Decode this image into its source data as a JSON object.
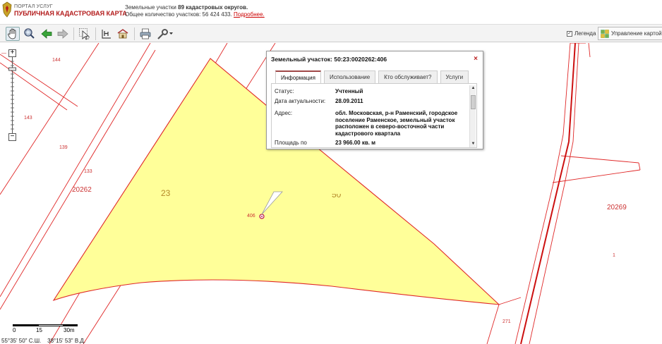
{
  "header": {
    "portal_label": "ПОРТАЛ УСЛУГ",
    "portal_title": "ПУБЛИЧНАЯ КАДАСТРОВАЯ КАРТА",
    "info_line1_prefix": "Земельные участки ",
    "info_line1_bold": "89 кадастровых округов.",
    "info_line2_prefix": "Общее количество участков: 56 424 433. ",
    "info_line2_link": "Подробнее."
  },
  "toolbar": {
    "legend_label": "Легенда",
    "legend_checked": "✓",
    "manage_label": "Управление картой",
    "icons": [
      "hand-icon",
      "zoom-area-icon",
      "back-arrow-icon",
      "forward-arrow-icon",
      "identify-icon",
      "measure-icon",
      "building-icon",
      "print-icon",
      "tools-icon"
    ]
  },
  "map": {
    "labels": [
      "144",
      "143",
      "139",
      "133",
      "20262",
      "406",
      "271",
      "20269",
      "1"
    ],
    "big_labels": [
      "23",
      "50"
    ],
    "parcel_color": "#ffff99",
    "boundary_color": "#e02828",
    "zoom_plus": "+",
    "zoom_minus": "−",
    "zoom_level_marker": "—",
    "scale": {
      "s0": "0",
      "s1": "15",
      "s2": "30m"
    },
    "coords": "55°35' 50\" С.Ш.    38°15' 53\" В.Д."
  },
  "popup": {
    "title": "Земельный участок: 50:23:0020262:406",
    "close": "×",
    "tabs": [
      "Информация",
      "Использование",
      "Кто обслуживает?",
      "Услуги"
    ],
    "fields": {
      "status_label": "Статус:",
      "status_value": "Учтенный",
      "date_label": "Дата актуальности:",
      "date_value": "28.09.2011",
      "address_label": "Адрес:",
      "address_value": "обл. Московская, р-н Раменский, городское поселение Раменское, земельный участок расположен в северо-восточной части кадастрового квартала",
      "area_label": "Площадь по",
      "area_value": "23 966.00 кв. м"
    },
    "scroll_up": "▲",
    "scroll_down": "▼"
  }
}
